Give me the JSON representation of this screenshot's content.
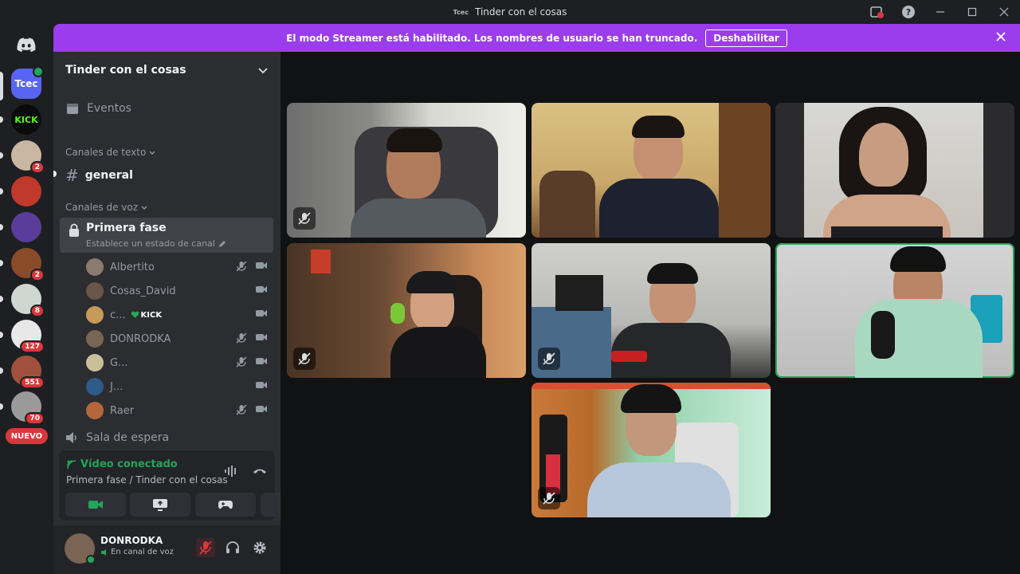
{
  "window": {
    "title": "Tinder con el cosas",
    "badge": "Tcec"
  },
  "banner": {
    "message": "El modo Streamer está habilitado. Los nombres de usuario se han truncado.",
    "button": "Deshabilitar"
  },
  "guilds": {
    "selected_label": "Tcec",
    "kick_label": "KICK",
    "badges": [
      "2",
      "2",
      "8",
      "127",
      "551",
      "70"
    ],
    "new_label": "NUEVO"
  },
  "sidebar": {
    "server_name": "Tinder con el cosas",
    "events_label": "Eventos",
    "text_category": "Canales de texto",
    "text_channel": "general",
    "voice_category": "Canales de voz",
    "voice_channel": {
      "name": "Primera fase",
      "status_placeholder": "Establece un estado de canal"
    },
    "members": [
      {
        "name": "Albertito",
        "muted": true,
        "color": "#8a7a70"
      },
      {
        "name": "Cosas_David",
        "muted": false,
        "color": "#6b5548"
      },
      {
        "name": "c...",
        "muted": false,
        "color": "#c79a5a",
        "tag": "KICK"
      },
      {
        "name": "DONRODKA",
        "muted": true,
        "color": "#7a6454"
      },
      {
        "name": "G...",
        "muted": true,
        "color": "#cbbf9a"
      },
      {
        "name": "J...",
        "muted": false,
        "color": "#2f5a8a"
      },
      {
        "name": "Raer",
        "muted": true,
        "color": "#b5653a"
      }
    ],
    "waiting_room": "Sala de espera"
  },
  "voice_panel": {
    "status": "Vídeo conectado",
    "location": "Primera fase / Tinder con el cosas"
  },
  "user": {
    "name": "DONRODKA",
    "status": "En canal de voz"
  },
  "colors": {
    "accent": "#9b3ded",
    "online": "#23a55a",
    "danger": "#da373c"
  }
}
